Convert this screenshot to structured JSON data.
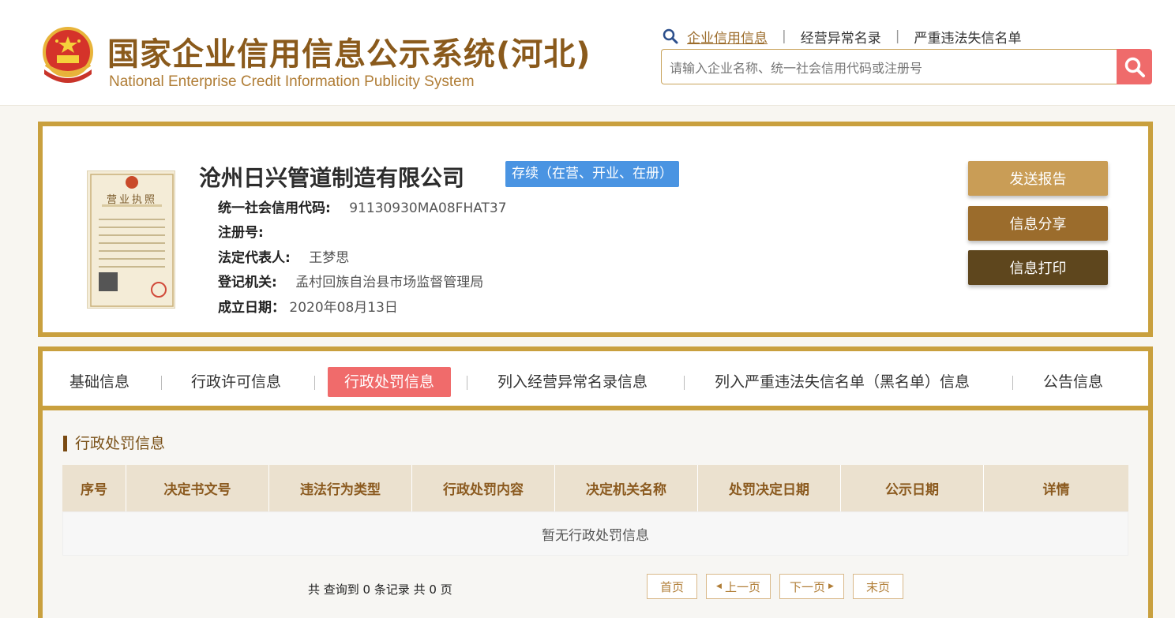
{
  "header": {
    "title_cn": "国家企业信用信息公示系统(河北)",
    "title_en": "National Enterprise Credit Information Publicity System",
    "links": [
      "企业信用信息",
      "经营异常名录",
      "严重违法失信名单"
    ],
    "separator": "|",
    "search_placeholder": "请输入企业名称、统一社会信用代码或注册号"
  },
  "company": {
    "name": "沧州日兴管道制造有限公司",
    "status": "存续（在营、开业、在册）",
    "credit_code_label": "统一社会信用代码:",
    "credit_code": "91130930MA08FHAT37",
    "reg_no_label": "注册号:",
    "reg_no": "",
    "legal_rep_label": "法定代表人:",
    "legal_rep": "王梦思",
    "authority_label": "登记机关:",
    "authority": "孟村回族自治县市场监督管理局",
    "established_label": "成立日期：",
    "established": "2020年08月13日",
    "license_title": "营业执照"
  },
  "actions": {
    "send_report": "发送报告",
    "share": "信息分享",
    "print": "信息打印"
  },
  "tabs": {
    "basic": "基础信息",
    "permit": "行政许可信息",
    "penalty": "行政处罚信息",
    "abnormal": "列入经营异常名录信息",
    "blacklist": "列入严重违法失信名单（黑名单）信息",
    "notice": "公告信息"
  },
  "section": {
    "title": "行政处罚信息",
    "columns": [
      "序号",
      "决定书文号",
      "违法行为类型",
      "行政处罚内容",
      "决定机关名称",
      "处罚决定日期",
      "公示日期",
      "详情"
    ],
    "empty_text": "暂无行政处罚信息"
  },
  "pagination": {
    "summary": "共 查询到 0 条记录 共 0 页",
    "first": "首页",
    "prev": "上一页",
    "next": "下一页",
    "last": "末页"
  },
  "colors": {
    "gold_border": "#c9a03e",
    "brand_brown": "#8a5a1c",
    "active_tab": "#f06b6b",
    "status_blue": "#4a94e2"
  }
}
